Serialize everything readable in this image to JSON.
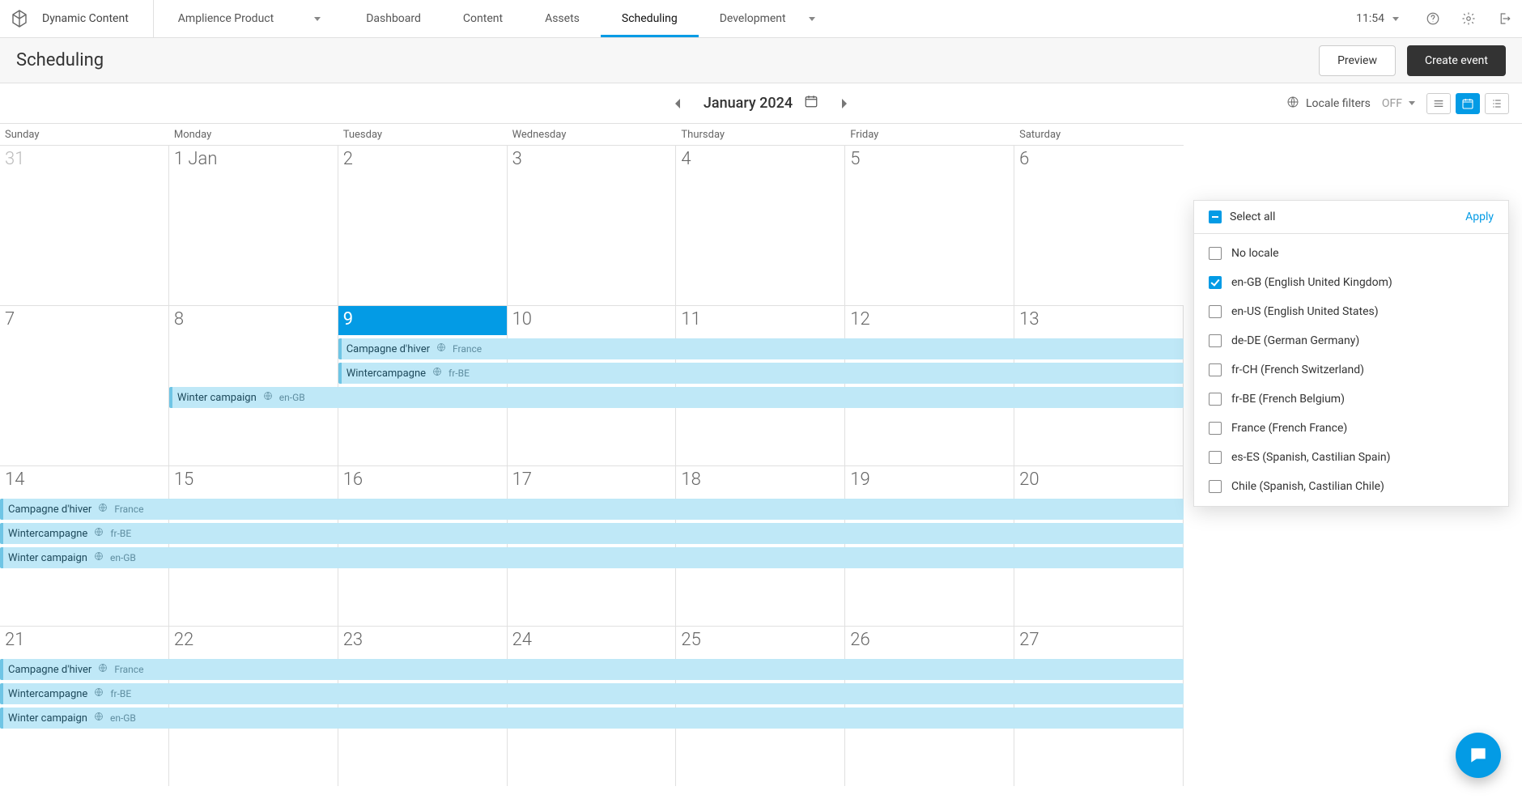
{
  "brand": "Dynamic Content",
  "hub_selector": {
    "label": "Amplience Product"
  },
  "nav": {
    "items": [
      {
        "label": "Dashboard",
        "has_caret": false
      },
      {
        "label": "Content",
        "has_caret": false
      },
      {
        "label": "Assets",
        "has_caret": false
      },
      {
        "label": "Scheduling",
        "has_caret": false
      },
      {
        "label": "Development",
        "has_caret": true
      }
    ],
    "active_index": 3
  },
  "clock": "11:54",
  "header_icons": [
    "help",
    "settings",
    "logout"
  ],
  "subheader": {
    "title": "Scheduling",
    "preview_label": "Preview",
    "create_label": "Create event"
  },
  "cal_controls": {
    "month_label": "January 2024",
    "locale_filters_label": "Locale filters",
    "locale_filters_state": "OFF",
    "view_modes": [
      "timeline",
      "month",
      "list"
    ],
    "active_view_index": 1
  },
  "dayheaders": [
    "Sunday",
    "Monday",
    "Tuesday",
    "Wednesday",
    "Thursday",
    "Friday",
    "Saturday"
  ],
  "weeks": [
    {
      "days": [
        {
          "num": "31",
          "other": true
        },
        {
          "num": "1 Jan"
        },
        {
          "num": "2"
        },
        {
          "num": "3"
        },
        {
          "num": "4"
        },
        {
          "num": "5"
        },
        {
          "num": "6"
        }
      ],
      "events_start_col": 0,
      "events": []
    },
    {
      "days": [
        {
          "num": "7"
        },
        {
          "num": "8"
        },
        {
          "num": "9",
          "today": true
        },
        {
          "num": "10"
        },
        {
          "num": "11"
        },
        {
          "num": "12"
        },
        {
          "num": "13"
        }
      ],
      "events_start_col": 2,
      "events_row_offset_cols": [
        2,
        2,
        1
      ],
      "events": [
        {
          "title": "Campagne d'hiver",
          "locale": "France"
        },
        {
          "title": "Wintercampagne",
          "locale": "fr-BE"
        },
        {
          "title": "Winter campaign",
          "locale": "en-GB"
        }
      ]
    },
    {
      "days": [
        {
          "num": "14"
        },
        {
          "num": "15"
        },
        {
          "num": "16"
        },
        {
          "num": "17"
        },
        {
          "num": "18"
        },
        {
          "num": "19"
        },
        {
          "num": "20"
        }
      ],
      "events_start_col": 0,
      "events": [
        {
          "title": "Campagne d'hiver",
          "locale": "France"
        },
        {
          "title": "Wintercampagne",
          "locale": "fr-BE"
        },
        {
          "title": "Winter campaign",
          "locale": "en-GB"
        }
      ]
    },
    {
      "days": [
        {
          "num": "21"
        },
        {
          "num": "22"
        },
        {
          "num": "23"
        },
        {
          "num": "24"
        },
        {
          "num": "25"
        },
        {
          "num": "26"
        },
        {
          "num": "27"
        }
      ],
      "events_start_col": 0,
      "events": [
        {
          "title": "Campagne d'hiver",
          "locale": "France"
        },
        {
          "title": "Wintercampagne",
          "locale": "fr-BE"
        },
        {
          "title": "Winter campaign",
          "locale": "en-GB"
        }
      ]
    }
  ],
  "locale_popover": {
    "select_all_label": "Select all",
    "select_all_state": "indeterminate",
    "apply_label": "Apply",
    "items": [
      {
        "label": "No locale",
        "checked": false
      },
      {
        "label": "en-GB (English United Kingdom)",
        "checked": true
      },
      {
        "label": "en-US (English United States)",
        "checked": false
      },
      {
        "label": "de-DE (German Germany)",
        "checked": false
      },
      {
        "label": "fr-CH (French Switzerland)",
        "checked": false
      },
      {
        "label": "fr-BE (French Belgium)",
        "checked": false
      },
      {
        "label": "France (French France)",
        "checked": false
      },
      {
        "label": "es-ES (Spanish, Castilian Spain)",
        "checked": false
      },
      {
        "label": "Chile (Spanish, Castilian Chile)",
        "checked": false
      }
    ]
  },
  "chat_fab_icon": "chat"
}
